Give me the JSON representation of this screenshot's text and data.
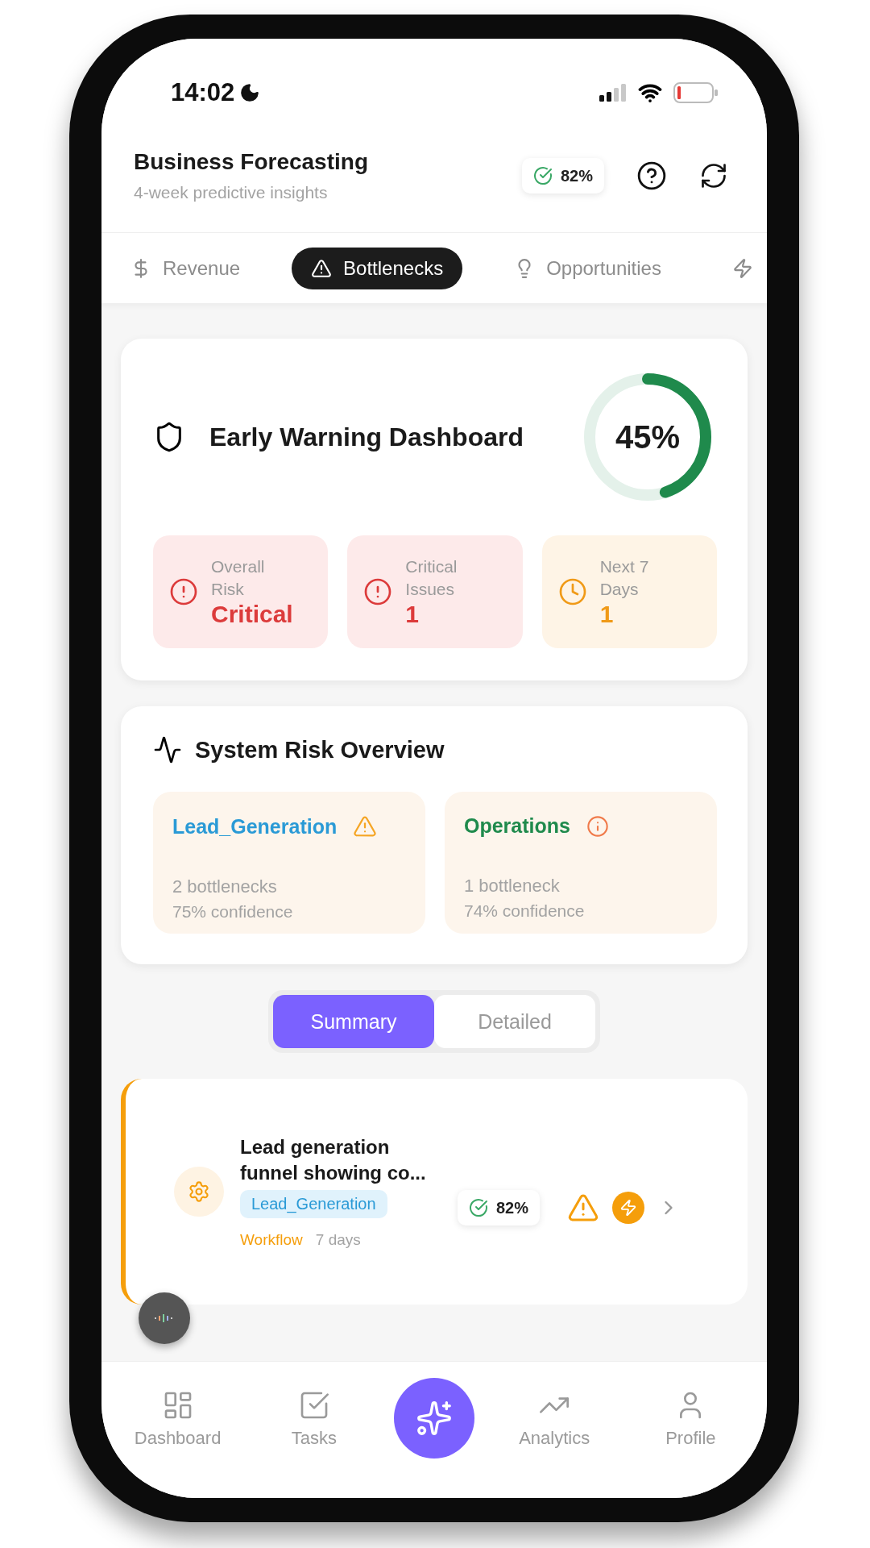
{
  "status_bar": {
    "time": "14:02"
  },
  "header": {
    "title": "Business Forecasting",
    "subtitle": "4-week predictive insights",
    "accuracy": "82%"
  },
  "tabs": [
    {
      "label": "Revenue",
      "kind": "dollar",
      "selected": false
    },
    {
      "label": "Bottlenecks",
      "kind": "alert",
      "selected": true
    },
    {
      "label": "Opportunities",
      "kind": "bulb",
      "selected": false
    },
    {
      "kind": "zap",
      "selected": false
    }
  ],
  "warning_card": {
    "title": "Early Warning Dashboard",
    "score": "45%",
    "level": 0.45,
    "metrics": [
      {
        "label": "Overall Risk",
        "value": "Critical",
        "kind": "danger"
      },
      {
        "label": "Critical Issues",
        "value": "1",
        "kind": "danger"
      },
      {
        "label": "Next 7 Days",
        "value": "1",
        "kind": "warning"
      }
    ]
  },
  "risk_overview": {
    "title": "System Risk Overview",
    "areas": [
      {
        "name": "Lead_Generation",
        "color": "#2a9ad6",
        "kind": "warning",
        "count": "2 bottlenecks",
        "confidence": "75% confidence"
      },
      {
        "name": "Operations",
        "color": "#1f8a4c",
        "kind": "info",
        "count": "1 bottleneck",
        "confidence": "74% confidence"
      }
    ]
  },
  "view_toggle": [
    {
      "label": "Summary",
      "selected": true
    },
    {
      "label": "Detailed",
      "selected": false
    }
  ],
  "items": [
    {
      "title": "Lead generation funnel showing co...",
      "tag": "Lead_Generation",
      "category": "Workflow",
      "timeframe": "7 days",
      "confidence": "82%"
    }
  ],
  "nav": [
    {
      "label": "Dashboard",
      "kind": "dashboard"
    },
    {
      "label": "Tasks",
      "kind": "tasks"
    },
    {
      "kind": "ai"
    },
    {
      "label": "Analytics",
      "kind": "analytics"
    },
    {
      "label": "Profile",
      "kind": "profile"
    }
  ]
}
